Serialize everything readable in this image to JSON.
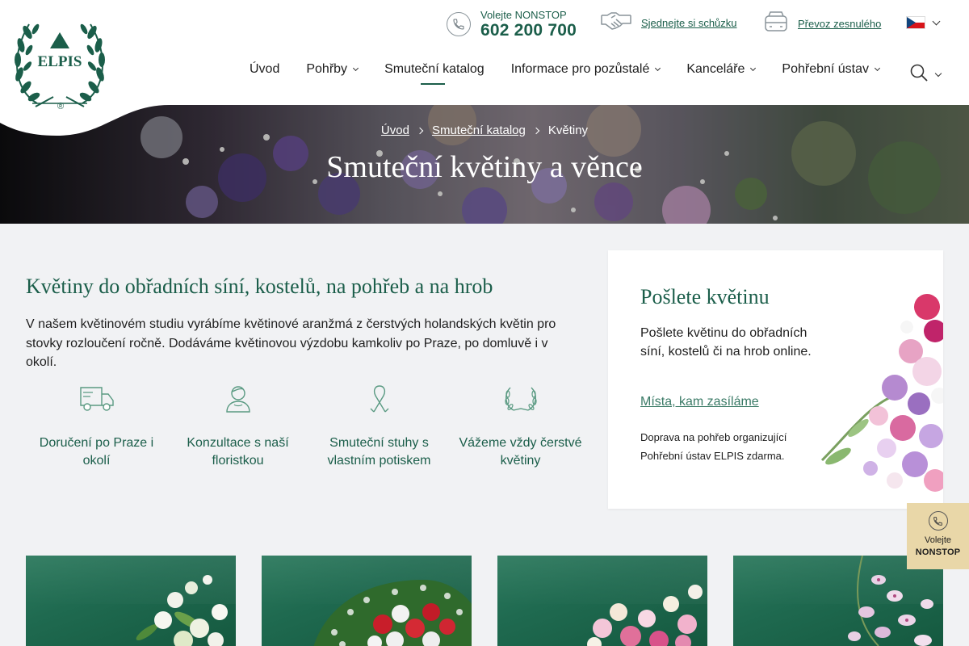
{
  "brand": {
    "name": "ELPIS",
    "registered": "®"
  },
  "topbar": {
    "phone_label": "Volejte NONSTOP",
    "phone_number": "602 200 700",
    "meet_link": "Sjednejte si schůzku",
    "transfer_link": "Převoz zesnulého",
    "language": "cs"
  },
  "nav": {
    "items": [
      {
        "label": "Úvod",
        "dropdown": false
      },
      {
        "label": "Pohřby",
        "dropdown": true
      },
      {
        "label": "Smuteční katalog",
        "dropdown": false,
        "active": true
      },
      {
        "label": "Informace pro pozůstalé",
        "dropdown": true
      },
      {
        "label": "Kanceláře",
        "dropdown": true
      },
      {
        "label": "Pohřební ústav",
        "dropdown": true
      }
    ],
    "search_icon": "search-icon"
  },
  "hero": {
    "breadcrumb": [
      "Úvod",
      "Smuteční katalog",
      "Květiny"
    ],
    "title": "Smuteční květiny a věnce"
  },
  "intro": {
    "heading": "Květiny do obřadních síní, kostelů, na pohřeb a na hrob",
    "text": "V našem květinovém studiu vyrábíme květinové aranžmá z čerstvých holandských květin pro stovky rozloučení ročně. Dodáváme květinovou výzdobu kamkoliv po Praze, po domluvě i v okolí."
  },
  "features": [
    {
      "icon": "delivery-truck-icon",
      "label": "Doručení po Praze i okolí"
    },
    {
      "icon": "florist-icon",
      "label": "Konzultace s naší floristkou"
    },
    {
      "icon": "ribbon-icon",
      "label": "Smuteční stuhy s vlastním potiskem"
    },
    {
      "icon": "wreath-icon",
      "label": "Vážeme vždy čerstvé květiny"
    }
  ],
  "card": {
    "title": "Pošlete květinu",
    "text": "Pošlete květinu do obřadních síní, kostelů či na hrob online.",
    "link": "Místa, kam zasíláme",
    "note": "Doprava na pohřeb organizující Pohřební ústav ELPIS zdarma."
  },
  "nonstop_badge": {
    "line1": "Volejte",
    "line2": "NONSTOP"
  },
  "products": [
    {
      "image": "white-wreath"
    },
    {
      "image": "red-white-wreath"
    },
    {
      "image": "pink-wreath"
    },
    {
      "image": "orchid-wreath"
    }
  ],
  "colors": {
    "accent": "#1b5e4a",
    "badge": "#e9d7a8",
    "background": "#f1f2f4"
  }
}
